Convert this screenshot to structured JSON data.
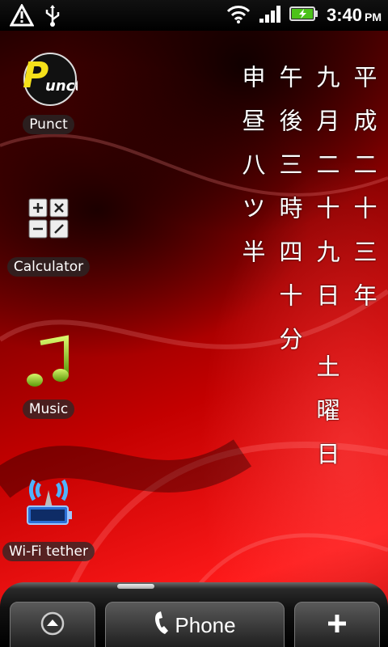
{
  "status_bar": {
    "time": "3:40",
    "ampm": "PM",
    "left_icons": [
      "warning-icon",
      "usb-icon"
    ],
    "right_icons": [
      "wifi-icon",
      "signal-icon",
      "battery-charging-icon"
    ]
  },
  "shortcuts": [
    {
      "label": "Punct",
      "icon": "punct-app-icon"
    },
    {
      "label": "Calculator",
      "icon": "calculator-icon"
    },
    {
      "label": "Music",
      "icon": "music-note-icon"
    },
    {
      "label": "Wi-Fi tether",
      "icon": "wifi-tether-icon"
    }
  ],
  "calendar_widget": {
    "columns": [
      "平成二十三年",
      "九月二十九日 土曜日",
      "午後三時四十分",
      "申昼八ツ半"
    ]
  },
  "dock": {
    "all_apps_icon": "up-arrow-icon",
    "phone_label": "Phone",
    "phone_icon": "phone-handset-icon",
    "add_icon": "plus-icon"
  }
}
